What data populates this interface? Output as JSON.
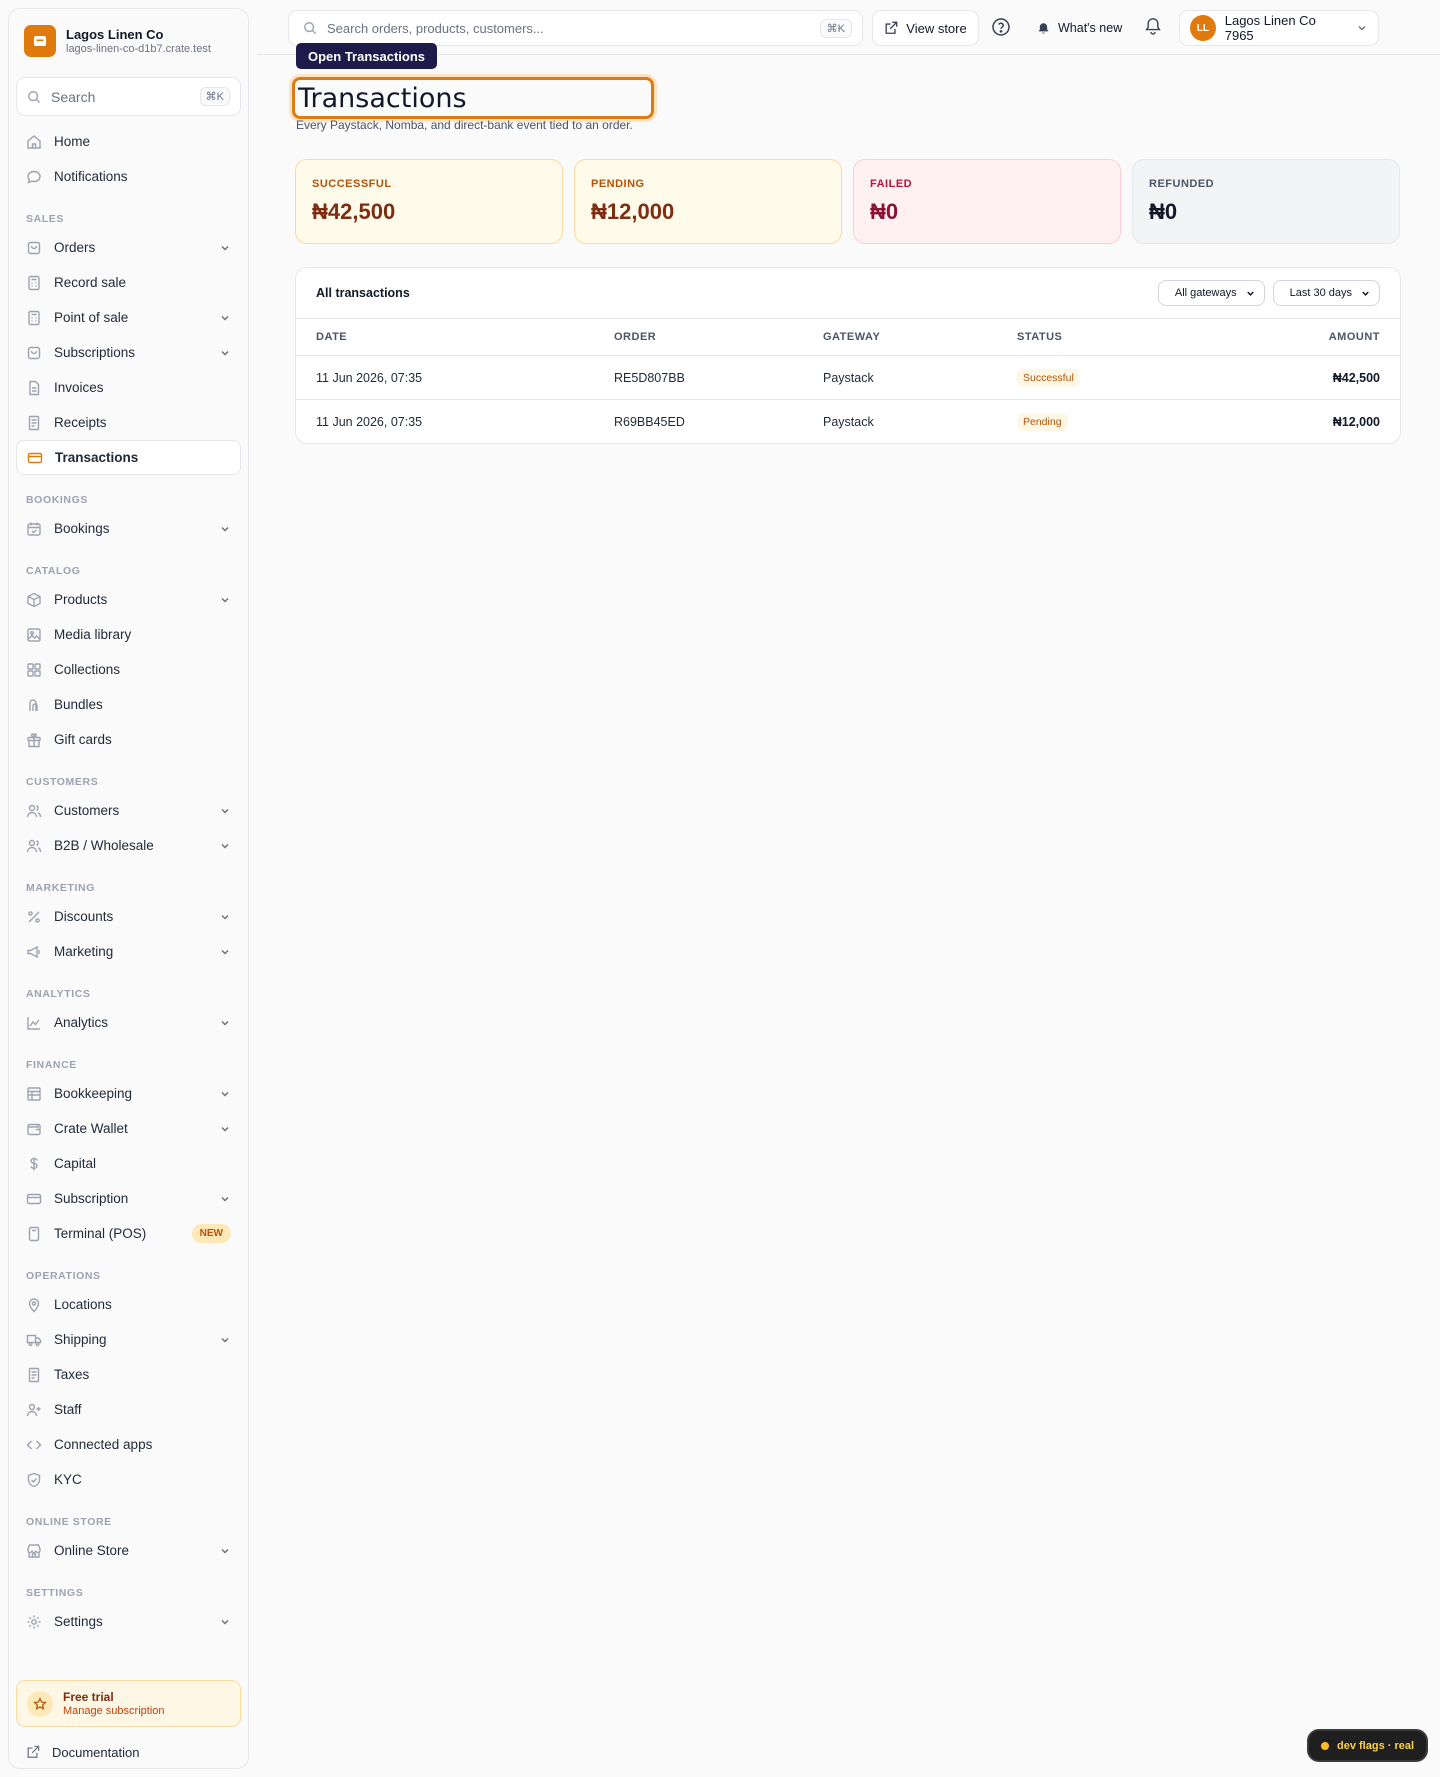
{
  "brand": {
    "name": "Lagos Linen Co",
    "domain": "lagos-linen-co-d1b7.crate.test"
  },
  "sidebar": {
    "search_label": "Search",
    "search_kbd": "⌘K",
    "top_items": [
      {
        "label": "Home",
        "icon": "home-icon"
      },
      {
        "label": "Notifications",
        "icon": "chat-icon"
      }
    ],
    "sections": {
      "sales": {
        "label": "SALES",
        "items": [
          "Orders",
          "Record sale",
          "Point of sale",
          "Subscriptions",
          "Invoices",
          "Receipts",
          "Transactions"
        ]
      },
      "bookings": {
        "label": "BOOKINGS",
        "items": [
          "Bookings"
        ]
      },
      "catalog": {
        "label": "CATALOG",
        "items": [
          "Products",
          "Media library",
          "Collections",
          "Bundles",
          "Gift cards"
        ]
      },
      "customers": {
        "label": "CUSTOMERS",
        "items": [
          "Customers",
          "B2B / Wholesale"
        ]
      },
      "marketing": {
        "label": "MARKETING",
        "items": [
          "Discounts",
          "Marketing"
        ]
      },
      "analytics": {
        "label": "ANALYTICS",
        "items": [
          "Analytics"
        ]
      },
      "finance": {
        "label": "FINANCE",
        "items": [
          "Bookkeeping",
          "Crate Wallet",
          "Capital",
          "Subscription",
          "Terminal (POS)"
        ],
        "new_badge": "NEW"
      },
      "operations": {
        "label": "OPERATIONS",
        "items": [
          "Locations",
          "Shipping",
          "Taxes",
          "Staff",
          "Connected apps",
          "KYC"
        ]
      },
      "online_store": {
        "label": "ONLINE STORE",
        "items": [
          "Online Store"
        ]
      },
      "settings": {
        "label": "SETTINGS",
        "items": [
          "Settings"
        ]
      }
    },
    "active_item": "Transactions",
    "trial": {
      "title": "Free trial",
      "subtitle": "Manage subscription"
    },
    "docs_label": "Documentation"
  },
  "topbar": {
    "search_placeholder": "Search orders, products, customers...",
    "search_kbd": "⌘K",
    "view_store": "View store",
    "whats_new": "What's new",
    "account_initials": "LL",
    "account_name": "Lagos Linen Co 7965"
  },
  "main": {
    "tooltip": "Open Transactions",
    "title": "Transactions",
    "subtitle": "Every Paystack, Nomba, and direct-bank event tied to an order.",
    "cards": [
      {
        "label": "SUCCESSFUL",
        "value": "₦42,500"
      },
      {
        "label": "PENDING",
        "value": "₦12,000"
      },
      {
        "label": "FAILED",
        "value": "₦0"
      },
      {
        "label": "REFUNDED",
        "value": "₦0"
      }
    ],
    "panel_title": "All transactions",
    "filters": {
      "gateway": "All gateways",
      "range": "Last 30 days"
    },
    "columns": [
      "DATE",
      "ORDER",
      "GATEWAY",
      "STATUS",
      "AMOUNT"
    ],
    "rows": [
      {
        "date": "11 Jun 2026, 07:35",
        "order": "RE5D807BB",
        "gateway": "Paystack",
        "status": "Successful",
        "amount": "₦42,500"
      },
      {
        "date": "11 Jun 2026, 07:35",
        "order": "R69BB45ED",
        "gateway": "Paystack",
        "status": "Pending",
        "amount": "₦12,000"
      }
    ]
  },
  "dev_flags": "dev flags · real",
  "colors": {
    "accent": "#e07a0c",
    "tooltip": "#1e1b4b"
  }
}
